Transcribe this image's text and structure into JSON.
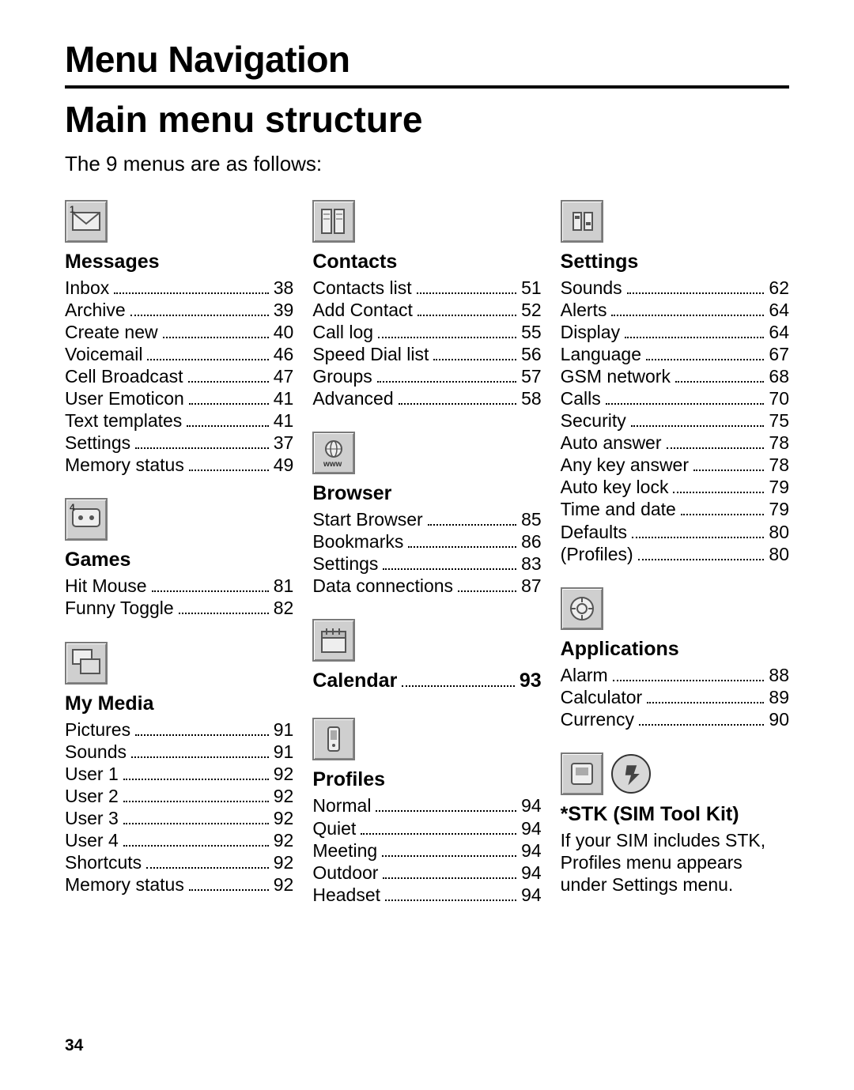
{
  "chapterTitle": "Menu Navigation",
  "sectionTitle": "Main menu structure",
  "intro": "The 9 menus are as follows:",
  "pageNumber": "34",
  "columns": [
    {
      "blocks": [
        {
          "icon": "messages-icon",
          "title": "Messages",
          "items": [
            {
              "label": "Inbox",
              "page": "38"
            },
            {
              "label": "Archive",
              "page": "39"
            },
            {
              "label": "Create new",
              "page": "40"
            },
            {
              "label": "Voicemail",
              "page": "46"
            },
            {
              "label": "Cell Broadcast",
              "page": "47"
            },
            {
              "label": "User Emoticon",
              "page": "41"
            },
            {
              "label": "Text templates",
              "page": "41"
            },
            {
              "label": "Settings",
              "page": "37"
            },
            {
              "label": "Memory status",
              "page": "49"
            }
          ]
        },
        {
          "icon": "games-icon",
          "title": "Games",
          "items": [
            {
              "label": "Hit Mouse",
              "page": "81"
            },
            {
              "label": "Funny Toggle",
              "page": "82"
            }
          ]
        },
        {
          "icon": "mymedia-icon",
          "title": "My Media",
          "items": [
            {
              "label": "Pictures",
              "page": "91"
            },
            {
              "label": "Sounds",
              "page": "91"
            },
            {
              "label": "User 1",
              "page": "92"
            },
            {
              "label": "User 2",
              "page": "92"
            },
            {
              "label": "User 3",
              "page": "92"
            },
            {
              "label": "User 4",
              "page": "92"
            },
            {
              "label": "Shortcuts",
              "page": "92"
            },
            {
              "label": "Memory status",
              "page": "92"
            }
          ]
        }
      ]
    },
    {
      "blocks": [
        {
          "icon": "contacts-icon",
          "title": "Contacts",
          "items": [
            {
              "label": "Contacts list",
              "page": "51"
            },
            {
              "label": "Add Contact",
              "page": "52"
            },
            {
              "label": "Call log",
              "page": "55"
            },
            {
              "label": "Speed Dial list",
              "page": "56"
            },
            {
              "label": "Groups",
              "page": "57"
            },
            {
              "label": "Advanced",
              "page": "58"
            }
          ]
        },
        {
          "icon": "browser-icon",
          "title": "Browser",
          "items": [
            {
              "label": "Start Browser",
              "page": "85"
            },
            {
              "label": "Bookmarks",
              "page": "86"
            },
            {
              "label": "Settings",
              "page": "83"
            },
            {
              "label": "Data connections",
              "page": "87"
            }
          ]
        },
        {
          "icon": "calendar-icon",
          "title": "Calendar",
          "titlePage": "93",
          "items": []
        },
        {
          "icon": "profiles-icon",
          "title": "Profiles",
          "items": [
            {
              "label": "Normal",
              "page": "94"
            },
            {
              "label": "Quiet",
              "page": "94"
            },
            {
              "label": "Meeting",
              "page": "94"
            },
            {
              "label": "Outdoor",
              "page": "94"
            },
            {
              "label": "Headset",
              "page": "94"
            }
          ]
        }
      ]
    },
    {
      "blocks": [
        {
          "icon": "settings-icon",
          "title": "Settings",
          "items": [
            {
              "label": "Sounds",
              "page": "62"
            },
            {
              "label": "Alerts",
              "page": "64"
            },
            {
              "label": "Display",
              "page": "64"
            },
            {
              "label": "Language",
              "page": "67"
            },
            {
              "label": "GSM network",
              "page": "68"
            },
            {
              "label": "Calls",
              "page": "70"
            },
            {
              "label": "Security",
              "page": "75"
            },
            {
              "label": "Auto answer",
              "page": "78"
            },
            {
              "label": "Any key answer",
              "page": "78"
            },
            {
              "label": "Auto key lock",
              "page": "79"
            },
            {
              "label": "Time and date",
              "page": "79"
            },
            {
              "label": "Defaults",
              "page": "80"
            },
            {
              "label": "(Profiles)",
              "page": "80"
            }
          ]
        },
        {
          "icon": "applications-icon",
          "title": "Applications",
          "items": [
            {
              "label": "Alarm",
              "page": "88"
            },
            {
              "label": "Calculator",
              "page": "89"
            },
            {
              "label": "Currency",
              "page": "90"
            }
          ]
        },
        {
          "icon": "stk-icon",
          "iconPair": true,
          "title": "*STK (SIM Tool Kit)",
          "note": "If your SIM includes STK, Profiles menu appears under Settings menu.",
          "items": []
        }
      ]
    }
  ]
}
